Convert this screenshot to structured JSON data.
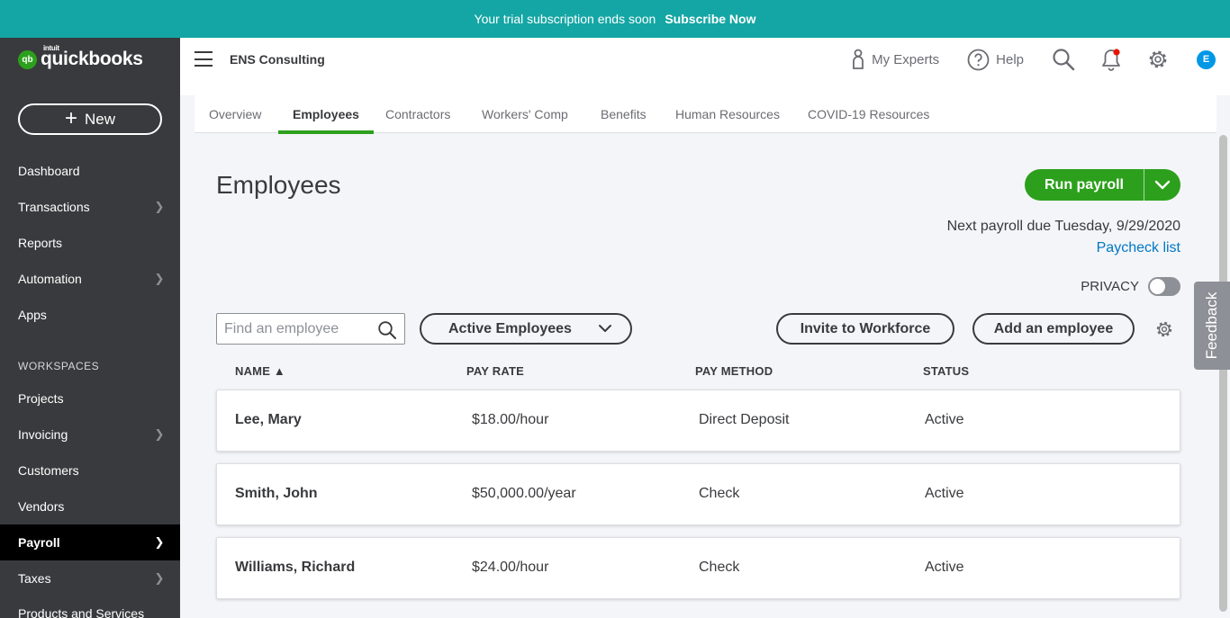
{
  "banner": {
    "message": "Your trial subscription ends soon",
    "cta": "Subscribe Now"
  },
  "brand": {
    "intuit": "intuit",
    "name": "quickbooks",
    "mark": "qb"
  },
  "sidebar": {
    "new_label": "New",
    "workspaces_label": "WORKSPACES",
    "items": [
      {
        "label": "Dashboard"
      },
      {
        "label": "Transactions"
      },
      {
        "label": "Reports"
      },
      {
        "label": "Automation"
      },
      {
        "label": "Apps"
      },
      {
        "label": "Projects"
      },
      {
        "label": "Invoicing"
      },
      {
        "label": "Customers"
      },
      {
        "label": "Vendors"
      },
      {
        "label": "Payroll"
      },
      {
        "label": "Taxes"
      },
      {
        "label": "Products and Services"
      }
    ]
  },
  "topbar": {
    "company": "ENS Consulting",
    "my_experts": "My Experts",
    "help": "Help",
    "avatar_initial": "E"
  },
  "tabs": [
    {
      "label": "Overview"
    },
    {
      "label": "Employees"
    },
    {
      "label": "Contractors"
    },
    {
      "label": "Workers' Comp"
    },
    {
      "label": "Benefits"
    },
    {
      "label": "Human Resources"
    },
    {
      "label": "COVID-19 Resources"
    }
  ],
  "main": {
    "title": "Employees",
    "run_payroll": "Run payroll",
    "next_payroll": "Next payroll due Tuesday, 9/29/2020",
    "paycheck_list": "Paycheck list",
    "privacy_label": "PRIVACY",
    "privacy_on": false,
    "search_placeholder": "Find an employee",
    "filter_selected": "Active Employees",
    "invite_label": "Invite to Workforce",
    "add_label": "Add an employee",
    "feedback_label": "Feedback"
  },
  "table": {
    "headers": {
      "name": "NAME ▲",
      "rate": "PAY RATE",
      "method": "PAY METHOD",
      "status": "STATUS"
    },
    "rows": [
      {
        "name": "Lee, Mary",
        "rate": "$18.00/hour",
        "method": "Direct Deposit",
        "status": "Active"
      },
      {
        "name": "Smith, John",
        "rate": "$50,000.00/year",
        "method": "Check",
        "status": "Active"
      },
      {
        "name": "Williams, Richard",
        "rate": "$24.00/hour",
        "method": "Check",
        "status": "Active"
      }
    ]
  },
  "colors": {
    "banner": "#14a6a4",
    "sidebar": "#393a3d",
    "accent_green": "#2ca01c",
    "link_blue": "#0077c5",
    "notification_dot": "#e81500"
  }
}
